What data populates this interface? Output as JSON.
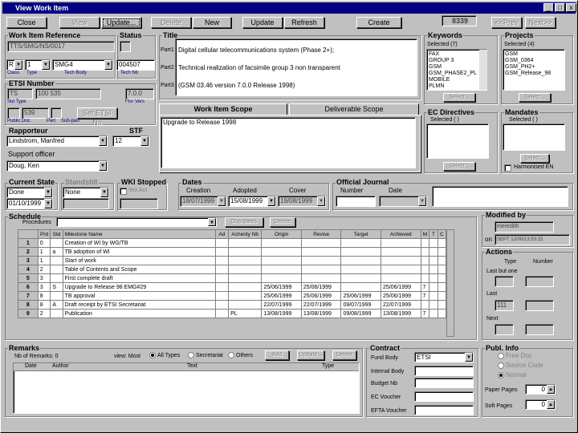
{
  "window": {
    "title": "View Work Item",
    "controls": [
      "_",
      "□",
      "x"
    ]
  },
  "toolbar": {
    "close": "Close",
    "view": "View",
    "update": "Update...",
    "delete": "Delete",
    "new": "New",
    "update2": "Update",
    "refresh": "Refresh",
    "create": "Create",
    "record_no": "8339",
    "prev": "<<Prev",
    "next": "Next>>"
  },
  "wir": {
    "label": "Work Item Reference",
    "value": "TTS/SMG/NS/0017",
    "status_label": "Status",
    "status_value": "",
    "type1": "R",
    "type2": "1",
    "body": "SMG4",
    "number": "004507",
    "sub_class": "Class",
    "sub_type": "Type",
    "sub_body": "Tech Body",
    "sub_number": "Tech Nb"
  },
  "etsi": {
    "label": "ETSI Number",
    "prefix": "TS",
    "num": "100 535",
    "ver": "7.0.0",
    "sub_doc": "Std Type",
    "sub_ver": "Ftsr Vers",
    "small1": "",
    "small2": "539",
    "small3": "",
    "btn": "Set ETSI No",
    "sub_a": "Public Doc",
    "sub_b": "Part",
    "sub_c": "Sub-part"
  },
  "rapporteur": {
    "label": "Rapporteur",
    "value": "Lindstrom, Manfred",
    "stf_label": "STF",
    "stf_value": "12"
  },
  "support": {
    "label": "Support officer",
    "value": "Doug, Ken"
  },
  "title": {
    "label": "Title",
    "p1_label": "Part1",
    "p1": "Digital cellular telecommunications system (Phase 2+);",
    "p2_label": "Part2",
    "p2": "Technical realization of facsimile group 3 non transparent",
    "p3_label": "Part3",
    "p3": "(GSM 03.46 version 7.0.0 Release 1998)"
  },
  "tabs": {
    "scope": "Work Item Scope",
    "deliverable": "Deliverable Scope"
  },
  "scope_text": "Upgrade to Release 1998",
  "keywords": {
    "label": "Keywords",
    "selected": "Selected (7)",
    "items": [
      "FAX",
      "GROUP 3",
      "GSM",
      "GSM_PHASE2_PL",
      "MOBILE",
      "PLMN"
    ],
    "btn": "Select..."
  },
  "projects": {
    "label": "Projects",
    "selected": "Selected (4)",
    "items": [
      "GSM",
      "GSM_0364",
      "GSM_PH2+",
      "GSM_Release_98"
    ],
    "btn": "Select..."
  },
  "ec": {
    "label": "EC Directives",
    "selected": "Selected ( )",
    "btn": "Select..."
  },
  "mandates": {
    "label": "Mandates",
    "selected": "Selected ( )",
    "btn": "Select...",
    "harmonised": "Harmonised EN"
  },
  "current_state": {
    "label": "Current State",
    "value": "Done",
    "date": "01/10/1999"
  },
  "standstill": {
    "label": "Standstill",
    "value": "None"
  },
  "wki": {
    "label": "WKI Stopped",
    "yes": "Yes",
    "yes_label": "Yes Act"
  },
  "dates": {
    "label": "Dates",
    "creation_label": "Creation",
    "creation": "18/07/1999",
    "adoption_label": "Adopted",
    "adoption": "15/08/1999",
    "cover_label": "Cover",
    "cover": "19/08/1999"
  },
  "oj": {
    "label": "Official Journal",
    "number_label": "Number",
    "date_label": "Date"
  },
  "schedule": {
    "label": "Schedule",
    "procedure_label": "Procedures",
    "btn_dup": "Dup dates",
    "btn_delete": "Delete",
    "columns": [
      "",
      "Prd",
      "Std",
      "Milestone Name",
      "Ad",
      "Acherity Nb",
      "Origin",
      "Revise",
      "Target",
      "Achieved",
      "M",
      "T",
      "C"
    ],
    "rows": [
      [
        "1",
        "0",
        "",
        "Creation of WI by WG/TB",
        "",
        "",
        "",
        "",
        "",
        "",
        "",
        "",
        ""
      ],
      [
        "2",
        "1",
        "a",
        "TB adoption of WI",
        "",
        "",
        "",
        "",
        "",
        "",
        "",
        "",
        ""
      ],
      [
        "3",
        "1",
        "",
        "Start of work",
        "",
        "",
        "",
        "",
        "",
        "",
        "",
        "",
        ""
      ],
      [
        "4",
        "2",
        "",
        "Table of Contents and Scope",
        "",
        "",
        "",
        "",
        "",
        "",
        "",
        "",
        ""
      ],
      [
        "5",
        "3",
        "",
        "First complete draft",
        "",
        "",
        "",
        "",
        "",
        "",
        "",
        "",
        ""
      ],
      [
        "6",
        "3",
        "S",
        "Upgrade to Release 98 EMG#29",
        "",
        "",
        "25/06/1999",
        "25/06/1999",
        "",
        "25/06/1999",
        "7",
        "",
        ""
      ],
      [
        "7",
        "8",
        "",
        "TB approval",
        "",
        "",
        "25/06/1999",
        "25/06/1999",
        "25/06/1999",
        "25/06/1999",
        "7",
        "",
        ""
      ],
      [
        "8",
        "8",
        "A",
        "Draft receipt by ETSI Secretariat",
        "",
        "",
        "22/07/1999",
        "22/07/1999",
        "09/07/1999",
        "22/07/1999",
        "",
        "",
        ""
      ],
      [
        "9",
        "2",
        "",
        "Publication",
        "",
        "PL",
        "13/08/1999",
        "13/08/1999",
        "09/08/1999",
        "13/08/1999",
        "7",
        "",
        ""
      ]
    ]
  },
  "modified": {
    "label": "Modified by",
    "user": "meredith",
    "on_label": "on",
    "on": "SEPT 12/00/13:53:15"
  },
  "actions": {
    "label": "Actions",
    "type": "Type",
    "number": "Number",
    "last_label": "Last but one",
    "last": "Last",
    "last_val": "111",
    "next": "Next"
  },
  "remarks": {
    "label": "Remarks",
    "count": "Nb of Remarks: 0",
    "view_label": "view: Most",
    "all": "All Types",
    "secretariat": "Secretariat",
    "others": "Others",
    "add": "Add",
    "update": "Update...",
    "delete": "Delete",
    "col_date": "Date",
    "col_author": "Author",
    "col_text": "Text",
    "col_type": "Type"
  },
  "contract": {
    "label": "Contract",
    "funded_label": "Fund Body",
    "funded": "ETSI",
    "name_label": "Internal Body",
    "number_label": "Budget Nb",
    "voucher_label": "EC Voucher",
    "efta_label": "EFTA Voucher"
  },
  "public_info": {
    "label": "Publ. Info",
    "free": "Free Doc",
    "source": "Source Code",
    "normal": "Normal",
    "paper_label": "Paper Pages",
    "paper": "0",
    "soft_label": "Soft Pages",
    "soft": "0"
  }
}
